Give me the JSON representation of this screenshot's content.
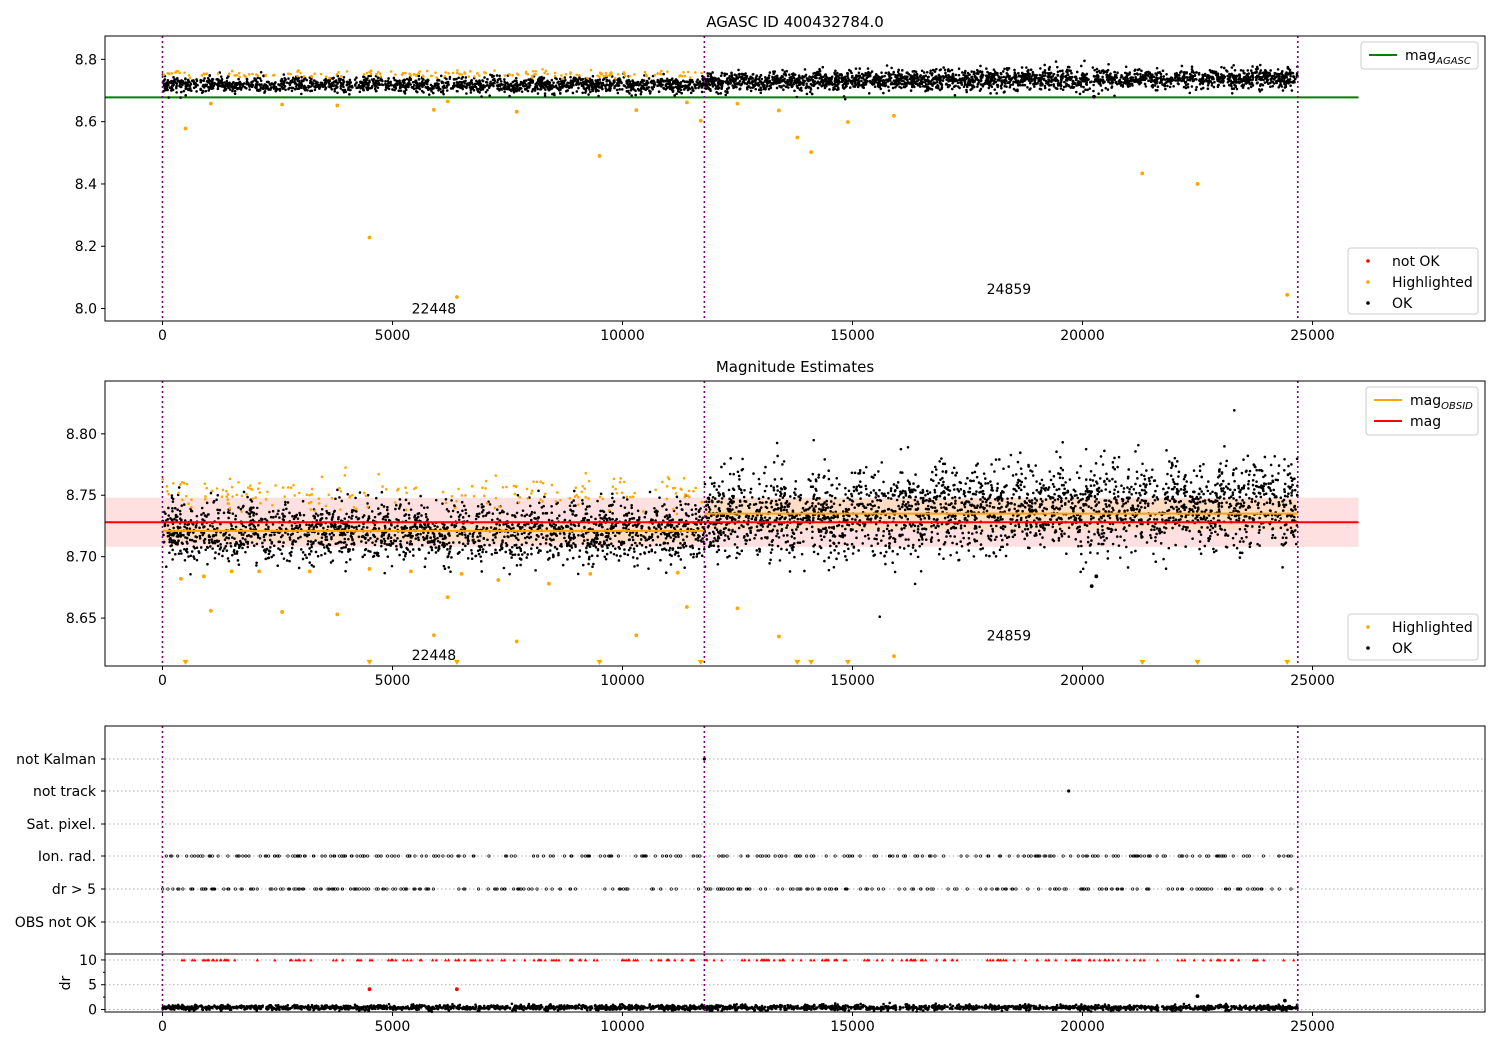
{
  "figure": {
    "title_top": "AGASC ID 400432784.0",
    "title_mid": "Magnitude Estimates"
  },
  "colors": {
    "ok": "#000000",
    "highlighted": "#ffa500",
    "not_ok": "#ff0000",
    "mag_agasc": "#008000",
    "mag": "#ff0000",
    "mag_obsid": "#ffa500",
    "obs_boundary": "#800080",
    "band_mag": "#ffcccc",
    "band_obsid": "#ffd8b0"
  },
  "chart_data": [
    {
      "id": "agasc",
      "type": "scatter",
      "title": "AGASC ID 400432784.0",
      "xlim": [
        -1250,
        28750
      ],
      "ylim": [
        7.96,
        8.875
      ],
      "xticks": [
        0,
        5000,
        10000,
        15000,
        20000,
        25000
      ],
      "xtick_labels": [
        "0",
        "5000",
        "10000",
        "15000",
        "20000",
        "25000"
      ],
      "yticks": [
        8.0,
        8.2,
        8.4,
        8.6,
        8.8
      ],
      "ytick_labels": [
        "8.0",
        "8.2",
        "8.4",
        "8.6",
        "8.8"
      ],
      "legend_top": {
        "placement": "upper-right",
        "entries": [
          {
            "label": "mag",
            "sub": "AGASC",
            "kind": "line",
            "color": "#008000"
          }
        ]
      },
      "legend_bottom": {
        "placement": "lower-right",
        "entries": [
          {
            "label": "not OK",
            "kind": "dot",
            "color": "#ff0000"
          },
          {
            "label": "Highlighted",
            "kind": "dot",
            "color": "#ffa500"
          },
          {
            "label": "OK",
            "kind": "dot",
            "color": "#000000"
          }
        ]
      },
      "hlines": [
        {
          "name": "mag_agasc",
          "y": 8.678,
          "x0": -1250,
          "x1": 26000,
          "color": "#008000"
        }
      ],
      "obs_boundaries": [
        0,
        11780,
        24680
      ],
      "obs_labels": [
        {
          "text": "22448",
          "x": 5900,
          "y": 8.0
        },
        {
          "text": "24859",
          "x": 18400,
          "y": 8.063
        }
      ],
      "series": [
        {
          "kind": "ok_cloud",
          "x0": 0,
          "x1": 11780,
          "center": 8.718,
          "spread": 0.012,
          "trend": 0,
          "n": 1700
        },
        {
          "kind": "ok_cloud",
          "x0": 11780,
          "x1": 24680,
          "center": 8.728,
          "spread": 0.016,
          "trend": 0.012,
          "n": 2400
        },
        {
          "kind": "highlight_band",
          "x0": 0,
          "x1": 11780,
          "center": 8.752,
          "spread": 0.006,
          "n": 170
        },
        {
          "kind": "points",
          "color": "#ffa500",
          "name": "Highlighted",
          "x": [
            500,
            1050,
            2600,
            3800,
            4500,
            5900,
            6200,
            6400,
            7700,
            9500,
            10300,
            11400,
            11700,
            12500,
            13400,
            13800,
            14100,
            14900,
            15900,
            21300,
            22500,
            24450
          ],
          "y": [
            8.578,
            8.658,
            8.655,
            8.652,
            8.228,
            8.638,
            8.665,
            8.037,
            8.632,
            8.49,
            8.637,
            8.662,
            8.603,
            8.658,
            8.636,
            8.549,
            8.502,
            8.599,
            8.619,
            8.434,
            8.4,
            8.044
          ]
        },
        {
          "kind": "points",
          "color": "#000000",
          "name": "OK",
          "x": [
            20250
          ],
          "y": [
            8.68
          ]
        }
      ]
    },
    {
      "id": "mag_estimates",
      "type": "scatter",
      "title": "Magnitude Estimates",
      "xlim": [
        -1250,
        28750
      ],
      "ylim": [
        8.611,
        8.843
      ],
      "xticks": [
        0,
        5000,
        10000,
        15000,
        20000,
        25000
      ],
      "xtick_labels": [
        "0",
        "5000",
        "10000",
        "15000",
        "20000",
        "25000"
      ],
      "yticks": [
        8.65,
        8.7,
        8.75,
        8.8
      ],
      "ytick_labels": [
        "8.65",
        "8.70",
        "8.75",
        "8.80"
      ],
      "legend_top": {
        "placement": "upper-right",
        "entries": [
          {
            "label": "mag",
            "sub": "OBSID",
            "kind": "line",
            "color": "#ffa500"
          },
          {
            "label": "mag",
            "sub": "",
            "kind": "line",
            "color": "#ff0000"
          }
        ]
      },
      "legend_bottom": {
        "placement": "lower-right",
        "entries": [
          {
            "label": "Highlighted",
            "kind": "dot",
            "color": "#ffa500"
          },
          {
            "label": "OK",
            "kind": "dot",
            "color": "#000000"
          }
        ]
      },
      "bands": [
        {
          "name": "mag_band",
          "x0": -1250,
          "x1": 26000,
          "y0": 8.708,
          "y1": 8.748,
          "color": "#ffcccc"
        },
        {
          "name": "obsid_band_1",
          "x0": 0,
          "x1": 11780,
          "y0": 8.712,
          "y1": 8.729,
          "color": "#ffd8b0"
        },
        {
          "name": "obsid_band_2",
          "x0": 11780,
          "x1": 24680,
          "y0": 8.722,
          "y1": 8.747,
          "color": "#ffd8b0"
        }
      ],
      "hlines": [
        {
          "name": "mag",
          "y": 8.728,
          "x0": -1250,
          "x1": 26000,
          "color": "#ff0000"
        },
        {
          "name": "mag_obsid_1",
          "y": 8.721,
          "x0": 0,
          "x1": 11780,
          "color": "#ffa500"
        },
        {
          "name": "mag_obsid_2",
          "y": 8.735,
          "x0": 11780,
          "x1": 24680,
          "color": "#ffa500"
        }
      ],
      "obs_boundaries": [
        0,
        11780,
        24680
      ],
      "obs_labels": [
        {
          "text": "22448",
          "x": 5900,
          "y": 8.62
        },
        {
          "text": "24859",
          "x": 18400,
          "y": 8.636
        }
      ],
      "series": [
        {
          "kind": "ok_cloud",
          "x0": 0,
          "x1": 11780,
          "center": 8.72,
          "spread": 0.012,
          "trend": 0,
          "n": 2000
        },
        {
          "kind": "ok_cloud",
          "x0": 11780,
          "x1": 24680,
          "center": 8.731,
          "spread": 0.017,
          "trend": 0.014,
          "n": 2600
        },
        {
          "kind": "highlight_band",
          "x0": 0,
          "x1": 11780,
          "center": 8.752,
          "spread": 0.007,
          "n": 190
        },
        {
          "kind": "points",
          "color": "#ffa500",
          "name": "Highlighted",
          "x": [
            400,
            900,
            1050,
            1500,
            2100,
            2600,
            3200,
            3800,
            4500,
            5400,
            5900,
            6200,
            6500,
            7300,
            7700,
            8400,
            9300,
            10300,
            11200,
            11400,
            12500,
            13400,
            15900
          ],
          "y": [
            8.682,
            8.684,
            8.656,
            8.688,
            8.688,
            8.655,
            8.688,
            8.653,
            8.69,
            8.688,
            8.636,
            8.667,
            8.686,
            8.681,
            8.631,
            8.678,
            8.686,
            8.636,
            8.687,
            8.659,
            8.658,
            8.635,
            8.619
          ]
        },
        {
          "kind": "points",
          "color": "#000000",
          "name": "OK",
          "x": [
            20200,
            20300
          ],
          "y": [
            8.676,
            8.684
          ]
        },
        {
          "kind": "triangles",
          "color": "#ffa500",
          "y": 8.6135,
          "x": [
            500,
            4500,
            6400,
            9500,
            11700,
            13800,
            14100,
            14900,
            21300,
            22500,
            24450
          ]
        }
      ]
    },
    {
      "id": "flags",
      "type": "scatter",
      "ylabel": "",
      "row_labels": [
        "not Kalman",
        "not track",
        "Sat. pixel.",
        "Ion. rad.",
        "dr > 5",
        "OBS not OK"
      ],
      "xlim": [
        -1250,
        28750
      ],
      "obs_boundaries": [
        0,
        11780,
        24680
      ],
      "rows": [
        {
          "label": "not Kalman",
          "points": [
            11780
          ]
        },
        {
          "label": "not track",
          "points": [
            19700
          ]
        },
        {
          "label": "Sat. pixel.",
          "points": []
        },
        {
          "label": "Ion. rad.",
          "clusters": [
            [
              0,
              11780
            ],
            [
              11780,
              24680
            ]
          ],
          "n": 260
        },
        {
          "label": "dr > 5",
          "clusters": [
            [
              0,
              11780
            ],
            [
              11780,
              24680
            ]
          ],
          "n": 260
        },
        {
          "label": "OBS not OK",
          "points": []
        }
      ]
    },
    {
      "id": "dr",
      "type": "scatter",
      "ylabel": "dr",
      "xlim": [
        -1250,
        28750
      ],
      "ylim": [
        -0.5,
        11.2
      ],
      "xticks": [
        0,
        5000,
        10000,
        15000,
        20000,
        25000
      ],
      "xtick_labels": [
        "0",
        "5000",
        "10000",
        "15000",
        "20000",
        "25000"
      ],
      "yticks": [
        0,
        5,
        10
      ],
      "ytick_labels": [
        "0",
        "5",
        "10"
      ],
      "obs_boundaries": [
        0,
        11780,
        24680
      ],
      "series": [
        {
          "kind": "ok_cloud",
          "x0": 0,
          "x1": 24680,
          "center": 0.4,
          "spread": 0.25,
          "trend": 0,
          "n": 2600
        },
        {
          "kind": "red_triangles",
          "y": 10.0,
          "x0": 0,
          "x1": 24680,
          "n": 230
        },
        {
          "kind": "points",
          "color": "#ff0000",
          "x": [
            4500,
            6400
          ],
          "y": [
            4.1,
            4.1
          ]
        },
        {
          "kind": "points",
          "color": "#000000",
          "x": [
            22500,
            24400
          ],
          "y": [
            2.7,
            1.8
          ]
        }
      ]
    }
  ]
}
